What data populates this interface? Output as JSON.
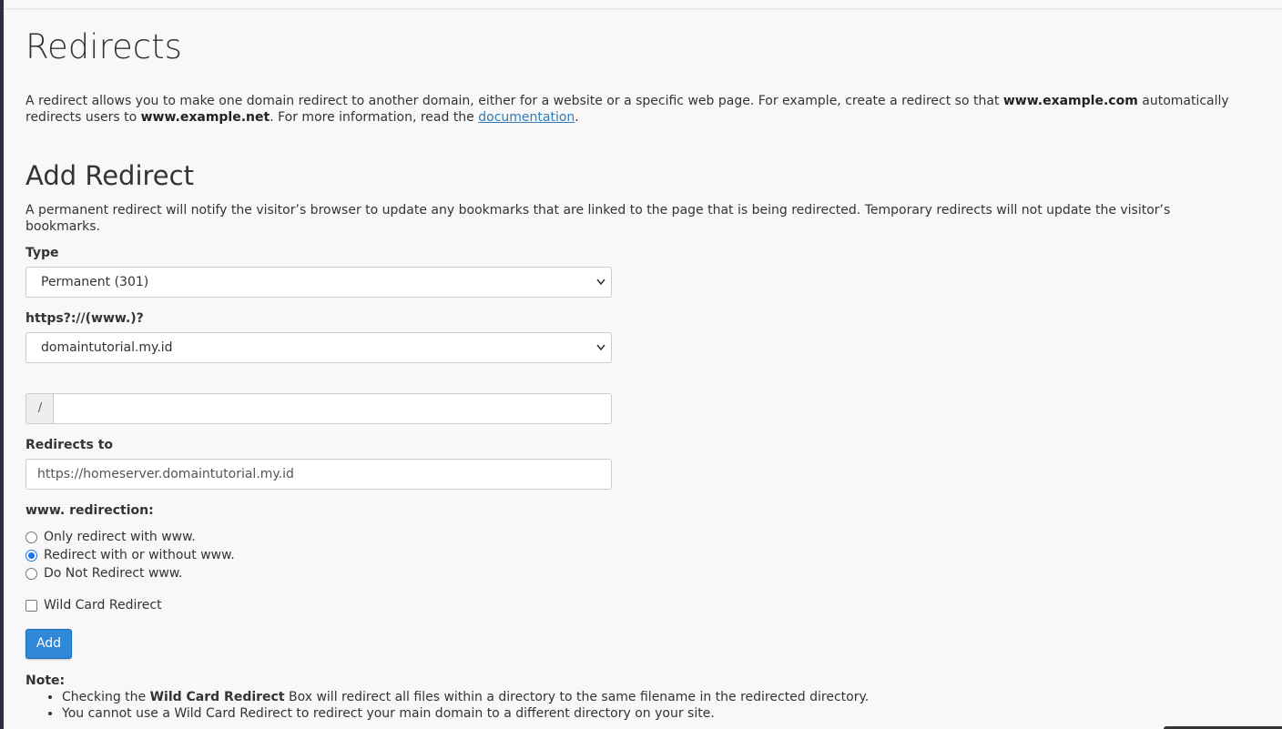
{
  "page": {
    "title": "Redirects",
    "intro": {
      "p1": "A redirect allows you to make one domain redirect to another domain, either for a website or a specific web page. For example, create a redirect so that ",
      "domain1": "www.example.com",
      "p2": " automatically redirects users to ",
      "domain2": "www.example.net",
      "p3": ". For more information, read the ",
      "link": "documentation",
      "p4": "."
    }
  },
  "add_redirect": {
    "heading": "Add Redirect",
    "description": "A permanent redirect will notify the visitor’s browser to update any bookmarks that are linked to the page that is being redirected. Temporary redirects will not update the visitor’s bookmarks.",
    "type_label": "Type",
    "type_value": "Permanent (301)",
    "domain_label": "https?://(www.)?",
    "domain_value": "domaintutorial.my.id",
    "path_prefix": "/",
    "path_value": "",
    "redirects_to_label": "Redirects to",
    "redirects_to_value": "https://homeserver.domaintutorial.my.id",
    "www_label": "www. redirection:",
    "www_options": [
      {
        "label": "Only redirect with www.",
        "checked": false
      },
      {
        "label": "Redirect with or without www.",
        "checked": true
      },
      {
        "label": "Do Not Redirect www.",
        "checked": false
      }
    ],
    "wildcard_label": "Wild Card Redirect",
    "wildcard_checked": false,
    "add_button": "Add"
  },
  "note": {
    "title": "Note:",
    "item1_prefix": "Checking the ",
    "item1_bold": "Wild Card Redirect",
    "item1_suffix": " Box will redirect all files within a directory to the same filename in the redirected directory.",
    "item2": "You cannot use a Wild Card Redirect to redirect your main domain to a different directory on your site."
  },
  "colors": {
    "accent": "#2f87d8",
    "link": "#337ab7",
    "radio_checked": "#1a73e8"
  },
  "icons": {
    "select_arrow": "chevron-down-icon"
  }
}
